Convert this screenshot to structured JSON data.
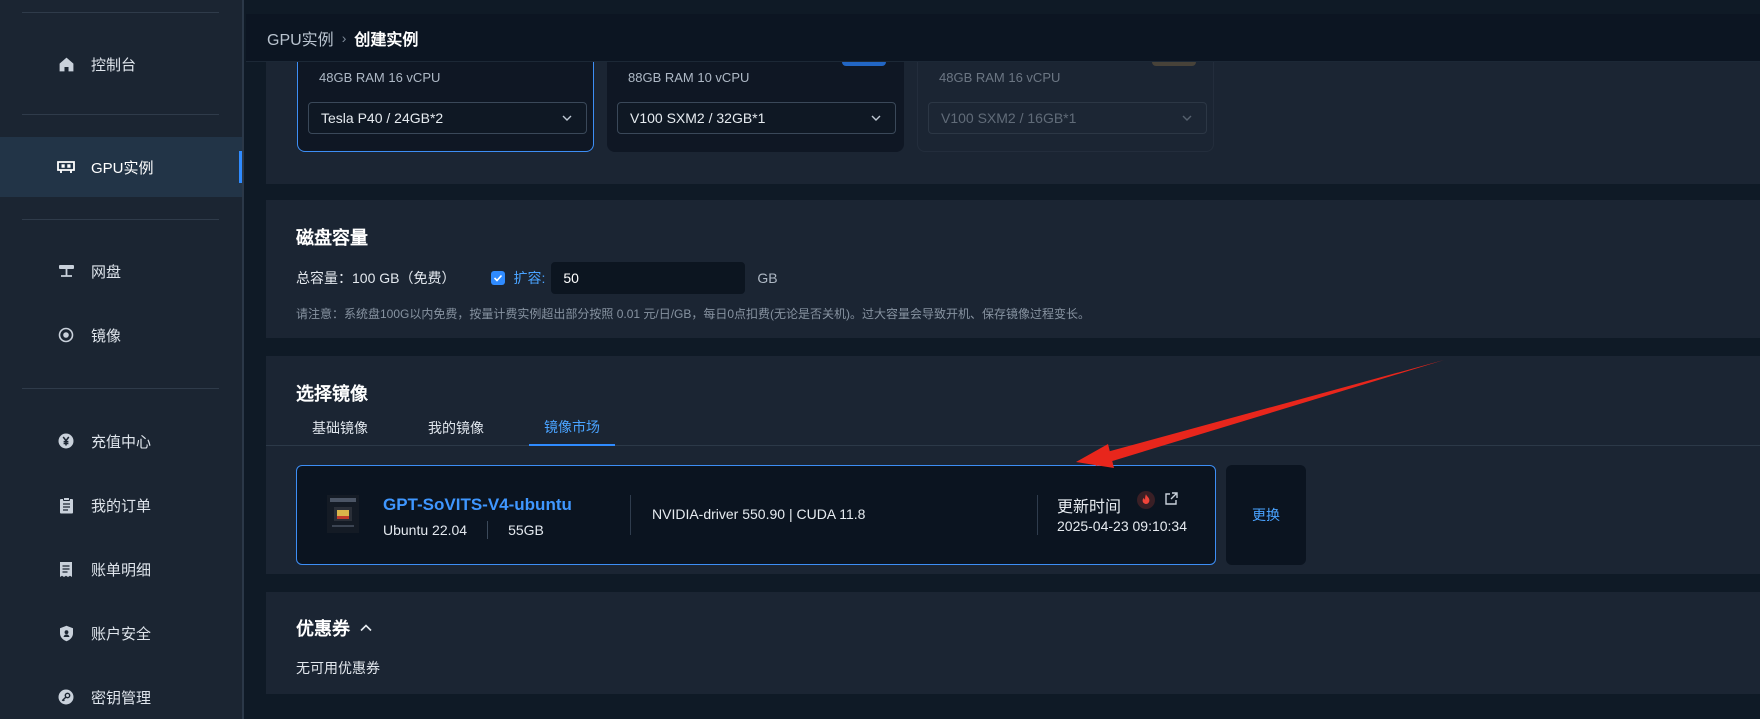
{
  "sidebar": {
    "items": [
      {
        "key": "console",
        "label": "控制台",
        "icon": "home-icon"
      },
      {
        "key": "gpu",
        "label": "GPU实例",
        "icon": "gpu-icon",
        "active": true
      },
      {
        "key": "netdisk",
        "label": "网盘",
        "icon": "netdisk-icon"
      },
      {
        "key": "mirror",
        "label": "镜像",
        "icon": "image-icon"
      },
      {
        "key": "recharge",
        "label": "充值中心",
        "icon": "yen-icon"
      },
      {
        "key": "orders",
        "label": "我的订单",
        "icon": "clipboard-icon"
      },
      {
        "key": "billing",
        "label": "账单明细",
        "icon": "receipt-icon"
      },
      {
        "key": "security",
        "label": "账户安全",
        "icon": "shield-icon"
      },
      {
        "key": "keys",
        "label": "密钥管理",
        "icon": "key-icon"
      }
    ]
  },
  "breadcrumb": {
    "parent": "GPU实例",
    "separator": "›",
    "current": "创建实例"
  },
  "gpu_cards": [
    {
      "spec": "48GB RAM 16 vCPU",
      "selected": "Tesla P40 / 24GB*2",
      "state": "selected"
    },
    {
      "spec": "88GB RAM 10 vCPU",
      "selected": "V100 SXM2 / 32GB*1",
      "state": "normal"
    },
    {
      "spec": "48GB RAM 16 vCPU",
      "selected": "V100 SXM2 / 16GB*1",
      "state": "disabled"
    }
  ],
  "disk": {
    "title": "磁盘容量",
    "total_label": "总容量：100 GB（免费）",
    "expand_label": "扩容:",
    "expand_checked": true,
    "expand_value": "50",
    "unit": "GB",
    "note": "请注意：系统盘100G以内免费，按量计费实例超出部分按照 0.01 元/日/GB，每日0点扣费(无论是否关机)。过大容量会导致开机、保存镜像过程变长。"
  },
  "image_section": {
    "title": "选择镜像",
    "tabs": [
      {
        "label": "基础镜像",
        "active": false
      },
      {
        "label": "我的镜像",
        "active": false
      },
      {
        "label": "镜像市场",
        "active": true
      }
    ],
    "selected_image": {
      "name": "GPT-SoVITS-V4-ubuntu",
      "os": "Ubuntu 22.04",
      "size": "55GB",
      "driver": "NVIDIA-driver 550.90 | CUDA 11.8",
      "updated_label": "更新时间",
      "updated_time": "2025-04-23 09:10:34"
    },
    "swap_label": "更换"
  },
  "coupon": {
    "title": "优惠券",
    "empty_text": "无可用优惠券"
  },
  "colors": {
    "accent": "#2f8bff",
    "link": "#3f97ff",
    "hot": "#e53935",
    "annotation_arrow": "#e8261c"
  }
}
